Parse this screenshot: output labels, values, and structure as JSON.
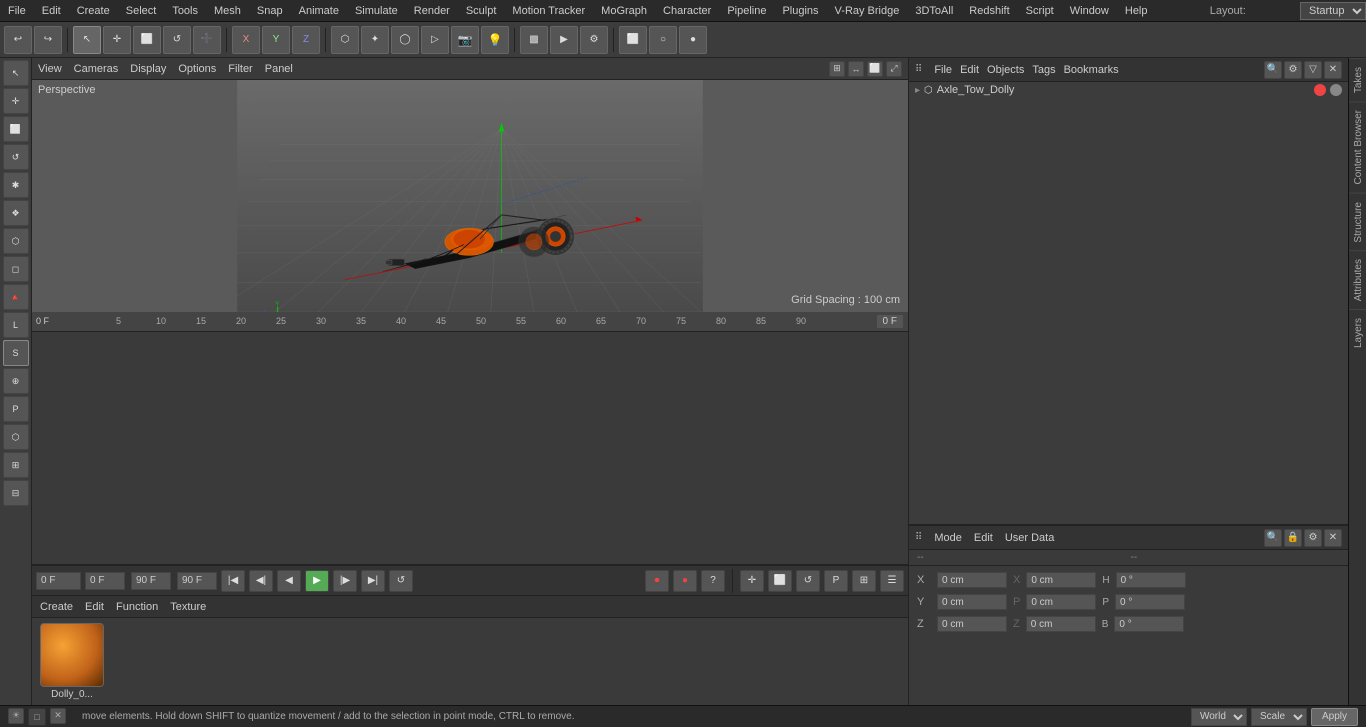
{
  "menubar": {
    "items": [
      "File",
      "Edit",
      "Create",
      "Select",
      "Tools",
      "Mesh",
      "Snap",
      "Animate",
      "Simulate",
      "Render",
      "Sculpt",
      "Motion Tracker",
      "MoGraph",
      "Character",
      "Pipeline",
      "Plugins",
      "V-Ray Bridge",
      "3DToAll",
      "Redshift",
      "Script",
      "Window",
      "Help"
    ],
    "layout_label": "Layout:",
    "layout_value": "Startup"
  },
  "toolbar": {
    "buttons": [
      "↩",
      "↪",
      "↖",
      "✛",
      "⬜",
      "↺",
      "➕",
      "X",
      "Y",
      "Z",
      "🟧",
      "▶",
      "⬡",
      "▪",
      "⊕",
      "⊞",
      "◯",
      "✦",
      "▷",
      "📷",
      "💡"
    ]
  },
  "left_panel": {
    "buttons": [
      "↖",
      "✛",
      "⬜",
      "↺",
      "✱",
      "❖",
      "⬡",
      "◻",
      "🔺",
      "L",
      "S",
      "⊕",
      "P",
      "⬡",
      "⊞",
      "⊟"
    ]
  },
  "viewport": {
    "menu_items": [
      "View",
      "Cameras",
      "Display",
      "Options",
      "Filter",
      "Panel"
    ],
    "perspective_label": "Perspective",
    "grid_spacing": "Grid Spacing : 100 cm"
  },
  "timeline": {
    "ruler_marks": [
      "0 F",
      "5",
      "10",
      "15",
      "20",
      "25",
      "30",
      "35",
      "40",
      "45",
      "50",
      "55",
      "60",
      "65",
      "70",
      "75",
      "80",
      "85",
      "90"
    ],
    "start_frame": "0 F",
    "end_frame": "90 F",
    "current_frame": "0 F",
    "preview_min": "90 F",
    "preview_max": "90 F",
    "frame_display": "0 F"
  },
  "object_manager": {
    "header_buttons": [
      "File",
      "Edit",
      "Objects",
      "Tags",
      "Bookmarks"
    ],
    "search_icon": "🔍",
    "objects": [
      {
        "name": "Axle_Tow_Dolly",
        "dot1": "red",
        "dot2": "grey",
        "indent": 0
      }
    ]
  },
  "attr_panel": {
    "header_buttons": [
      "Mode",
      "Edit",
      "User Data"
    ],
    "rows": [
      {
        "label": "X",
        "val1": "0 cm",
        "label2": "X",
        "val2": "0 cm",
        "label3": "H",
        "val3": "0 °"
      },
      {
        "label": "Y",
        "val1": "0 cm",
        "label2": "P",
        "val2": "0 cm",
        "label3": "P",
        "val3": "0 °"
      },
      {
        "label": "Z",
        "val1": "0 cm",
        "label2": "Z",
        "val2": "0 cm",
        "label3": "B",
        "val3": "0 °"
      }
    ]
  },
  "material_editor": {
    "header_buttons": [
      "Create",
      "Edit",
      "Function",
      "Texture"
    ],
    "materials": [
      {
        "name": "Dolly_0..."
      }
    ]
  },
  "status_bar": {
    "message": "move elements. Hold down SHIFT to quantize movement / add to the selection in point mode, CTRL to remove.",
    "world_label": "World",
    "scale_label": "Scale",
    "apply_label": "Apply"
  },
  "side_tabs": [
    "Takes",
    "Content Browser",
    "Structure",
    "Attributes",
    "Layers"
  ]
}
